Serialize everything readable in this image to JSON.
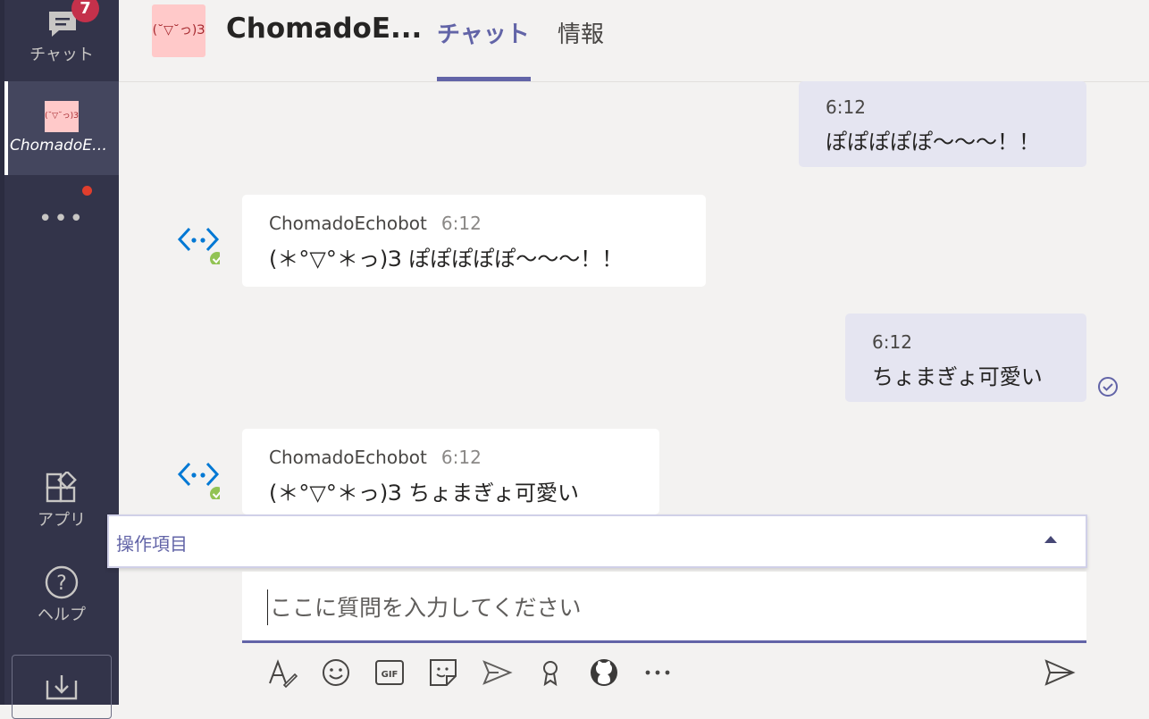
{
  "rail": {
    "chat_label": "チャット",
    "chat_badge": "7",
    "active_label": "ChomadoEc...",
    "active_thumb": "(˘▽˘っ)З",
    "more": "•••",
    "apps_label": "アプリ",
    "help_label": "ヘルプ"
  },
  "header": {
    "avatar_text": "(˘▽˘っ)З",
    "title": "ChomadoE...",
    "tabs": [
      {
        "label": "チャット",
        "active": true
      },
      {
        "label": "情報",
        "active": false
      }
    ]
  },
  "messages": [
    {
      "from": "me",
      "time": "6:12",
      "text": "ぽぽぽぽぽ〜〜〜！！"
    },
    {
      "from": "bot",
      "sender": "ChomadoEchobot",
      "time": "6:12",
      "text": "(＊°▽°＊っ)З ぽぽぽぽぽ〜〜〜！！"
    },
    {
      "from": "me",
      "time": "6:12",
      "text": "ちょまぎょ可愛い"
    },
    {
      "from": "bot",
      "sender": "ChomadoEchobot",
      "time": "6:12",
      "text": "(＊°▽°＊っ)З ちょまぎょ可愛い"
    }
  ],
  "actions": {
    "label": "操作項目"
  },
  "compose": {
    "placeholder": "ここに質問を入力してください",
    "value": ""
  },
  "toolbar": {
    "icons": [
      "format-icon",
      "emoji-icon",
      "gif-icon",
      "sticker-icon",
      "schedule-meeting-icon",
      "praise-icon",
      "github-icon",
      "more-options-icon",
      "send-icon"
    ]
  },
  "colors": {
    "accent": "#6264a7",
    "rail": "#33344a",
    "badge": "#c4314b",
    "mine_bubble": "#e5e5f1",
    "presence": "#92c353"
  }
}
